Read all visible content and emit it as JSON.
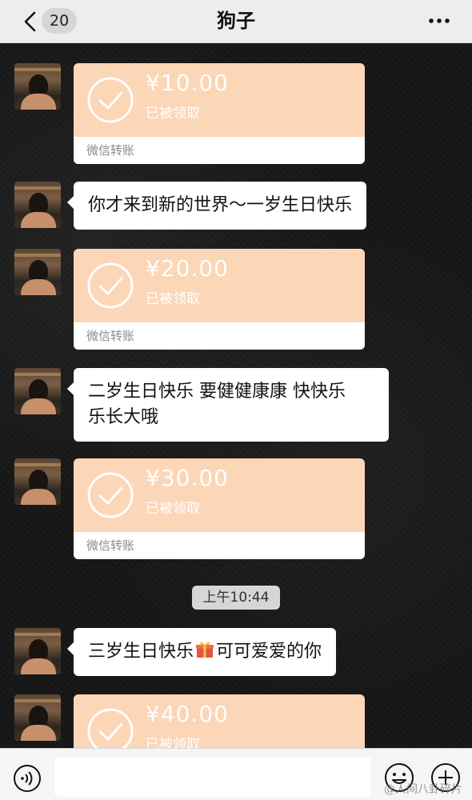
{
  "header": {
    "back_badge": "20",
    "title": "狗子"
  },
  "messages": [
    {
      "type": "transfer",
      "amount": "¥10.00",
      "status": "已被领取",
      "footer": "微信转账"
    },
    {
      "type": "text",
      "text": "你才来到新的世界～一岁生日快乐"
    },
    {
      "type": "transfer",
      "amount": "¥20.00",
      "status": "已被领取",
      "footer": "微信转账"
    },
    {
      "type": "text",
      "line1": "二岁生日快乐 要健健康康 快快乐",
      "line2": "乐长大哦"
    },
    {
      "type": "transfer",
      "amount": "¥30.00",
      "status": "已被领取",
      "footer": "微信转账"
    },
    {
      "type": "time",
      "text": "上午10:44"
    },
    {
      "type": "text",
      "before": "三岁生日快乐",
      "icon": "gift-icon",
      "after": "可可爱爱的你"
    },
    {
      "type": "transfer",
      "amount": "¥40.00",
      "status": "已被领取"
    }
  ],
  "footer": {
    "watermark": "@人间八卦碎片"
  },
  "colors": {
    "transfer_bg": "#fbd6b7",
    "bubble_bg": "#ffffff",
    "chat_bg": "#181818"
  }
}
